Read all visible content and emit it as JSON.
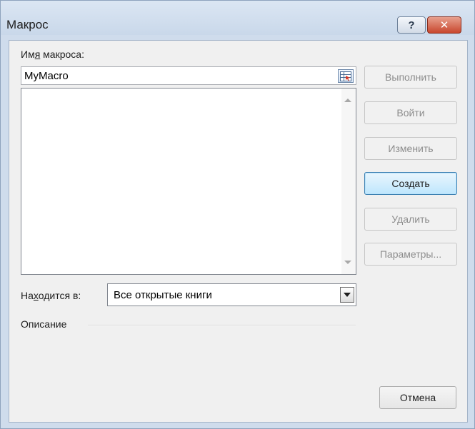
{
  "window": {
    "title": "Макрос",
    "help_glyph": "?",
    "close_glyph": "✕"
  },
  "macro_name": {
    "label_before": "Им",
    "label_mnemonic": "я",
    "label_after": " макроса:",
    "value": "MyMacro"
  },
  "macro_list": {
    "items": []
  },
  "location": {
    "label_before": "На",
    "label_mnemonic": "х",
    "label_after": "одится в:",
    "selected": "Все открытые книги"
  },
  "description": {
    "label": "Описание",
    "text": ""
  },
  "buttons": {
    "run": "Выполнить",
    "step_into": "Войти",
    "edit": "Изменить",
    "create_before": "Соз",
    "create_mnemonic": "д",
    "create_after": "ать",
    "delete": "Удалить",
    "options": "Параметры...",
    "cancel": "Отмена"
  },
  "colors": {
    "frame": "#cfdcec",
    "client": "#f0f0f0",
    "close_red": "#c8472e",
    "default_button": "#bee6fd"
  }
}
